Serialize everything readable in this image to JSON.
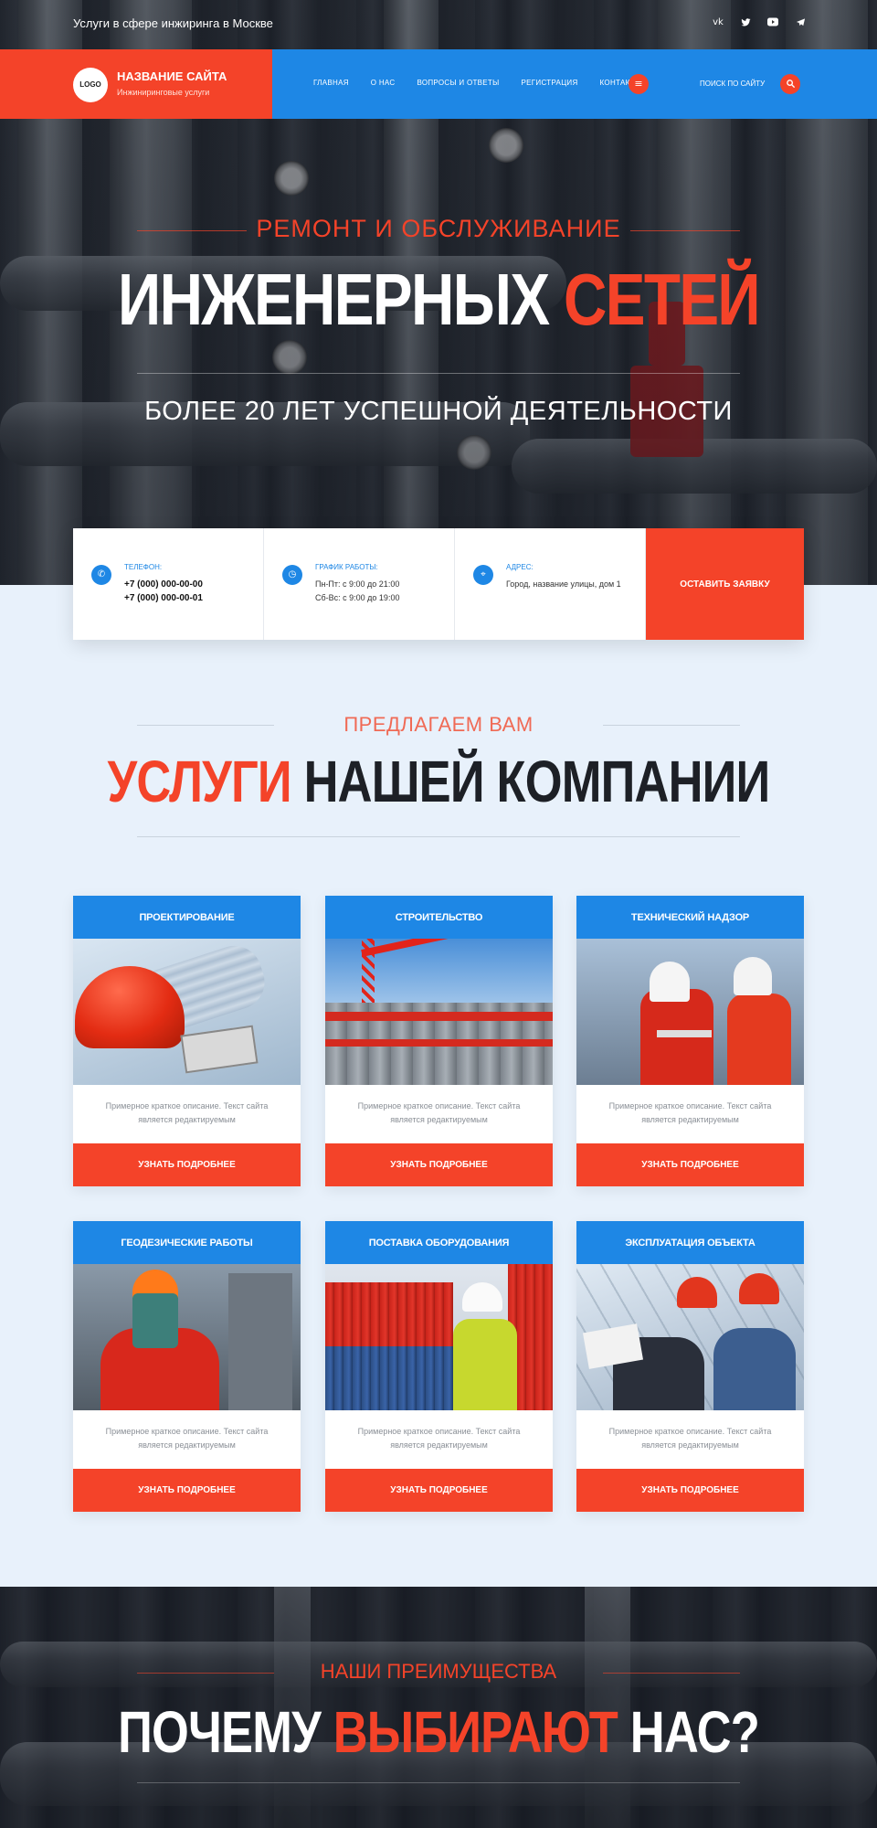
{
  "topbar": {
    "tagline": "Услуги в сфере инжиринга в Москве",
    "socials": [
      "vk-icon",
      "twitter-icon",
      "youtube-icon",
      "telegram-icon"
    ]
  },
  "brand": {
    "logo": "LOGO",
    "name": "НАЗВАНИЕ САЙТА",
    "subtitle": "Инжиниринговые услуги"
  },
  "menu": {
    "items": [
      "ГЛАВНАЯ",
      "О НАС",
      "ВОПРОСЫ И ОТВЕТЫ",
      "РЕГИСТРАЦИЯ",
      "КОНТАКТЫ"
    ],
    "search_label": "ПОИСК ПО САЙТУ"
  },
  "hero": {
    "kicker": "РЕМОНТ И ОБСЛУЖИВАНИЕ",
    "title_main": "ИНЖЕНЕРНЫХ ",
    "title_accent": "СЕТЕЙ",
    "subtitle": "БОЛЕЕ 20 ЛЕТ УСПЕШНОЙ ДЕЯТЕЛЬНОСТИ"
  },
  "info": {
    "phone_label": "ТЕЛЕФОН:",
    "phone_1": "+7 (000) 000-00-00",
    "phone_2": "+7 (000) 000-00-01",
    "hours_label": "ГРАФИК РАБОТЫ:",
    "hours_1": "Пн-Пт: с 9:00 до 21:00",
    "hours_2": "Сб-Вс: с 9:00 до 19:00",
    "address_label": "АДРЕС:",
    "address": "Город, название улицы, дом 1",
    "cta": "ОСТАВИТЬ ЗАЯВКУ"
  },
  "services": {
    "kicker": "ПРЕДЛАГАЕМ ВАМ",
    "title_accent": "УСЛУГИ",
    "title_main": " НАШЕЙ КОМПАНИИ",
    "cards": [
      {
        "title": "ПРОЕКТИРОВАНИЕ",
        "desc": "Примерное краткое описание. Текст сайта является редактируемым",
        "button": "УЗНАТЬ ПОДРОБНЕЕ"
      },
      {
        "title": "СТРОИТЕЛЬСТВО",
        "desc": "Примерное краткое описание. Текст сайта является редактируемым",
        "button": "УЗНАТЬ ПОДРОБНЕЕ"
      },
      {
        "title": "ТЕХНИЧЕСКИЙ НАДЗОР",
        "desc": "Примерное краткое описание. Текст сайта является редактируемым",
        "button": "УЗНАТЬ ПОДРОБНЕЕ"
      },
      {
        "title": "ГЕОДЕЗИЧЕСКИЕ РАБОТЫ",
        "desc": "Примерное краткое описание. Текст сайта является редактируемым",
        "button": "УЗНАТЬ ПОДРОБНЕЕ"
      },
      {
        "title": "ПОСТАВКА ОБОРУДОВАНИЯ",
        "desc": "Примерное краткое описание. Текст сайта является редактируемым",
        "button": "УЗНАТЬ ПОДРОБНЕЕ"
      },
      {
        "title": "ЭКСПЛУАТАЦИЯ ОБЪЕКТА",
        "desc": "Примерное краткое описание. Текст сайта является редактируемым",
        "button": "УЗНАТЬ ПОДРОБНЕЕ"
      }
    ]
  },
  "advantages": {
    "kicker": "НАШИ ПРЕИМУЩЕСТВА",
    "title_a": "ПОЧЕМУ ",
    "title_accent": "ВЫБИРАЮТ",
    "title_b": " НАС?"
  },
  "colors": {
    "accent_red": "#f44329",
    "accent_blue": "#1e87e5",
    "page_bg": "#e8f1fb"
  }
}
